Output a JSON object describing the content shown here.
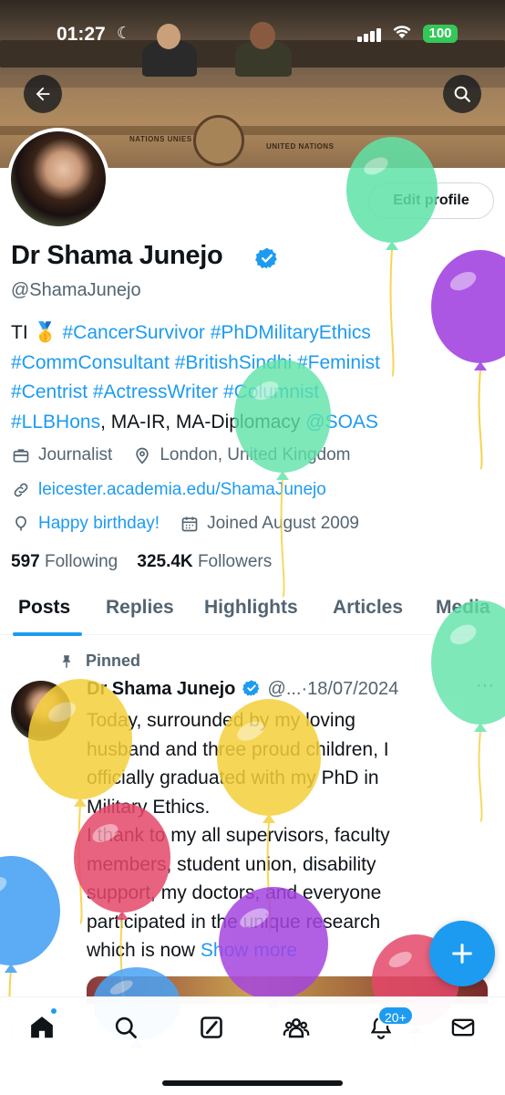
{
  "status_bar": {
    "time": "01:27",
    "battery": "100"
  },
  "profile": {
    "display_name": "Dr Shama Junejo",
    "handle": "@ShamaJunejo",
    "edit_profile_label": "Edit profile",
    "bio_lines": [
      [
        {
          "t": "TI 🥇 ",
          "tag": false
        },
        {
          "t": "#CancerSurvivor #PhDMilitaryEthics",
          "tag": true
        }
      ],
      [
        {
          "t": "#CommConsultant #BritishSindhi #Feminist",
          "tag": true
        }
      ],
      [
        {
          "t": "#Centrist #ActressWriter #Columnist",
          "tag": true
        }
      ],
      [
        {
          "t": "#LLBHons",
          "tag": true
        },
        {
          "t": ", MA-IR, MA-Diplomacy ",
          "tag": false
        },
        {
          "t": "@SOAS",
          "tag": true
        }
      ]
    ],
    "category": "Journalist",
    "location": "London, United Kingdom",
    "website": "leicester.academia.edu/ShamaJunejo",
    "birthday": "Happy birthday!",
    "joined": "Joined August 2009",
    "following_count": "597",
    "following_label": "Following",
    "followers_count": "325.4K",
    "followers_label": "Followers"
  },
  "tabs": [
    "Posts",
    "Replies",
    "Highlights",
    "Articles",
    "Media"
  ],
  "active_tab": "Posts",
  "post": {
    "pinned_label": "Pinned",
    "author": "Dr Shama Junejo",
    "handle_trunc": "@...",
    "date": "·18/07/2024",
    "more_icon": "···",
    "text_lines": [
      "Today, surrounded by my loving",
      "husband and three proud children, I",
      "officially graduated with my PhD in",
      "Military Ethics.",
      "I thank to my all supervisors, faculty",
      "members, student union, disability",
      "support, my doctors, and everyone",
      "participated in the unique research"
    ],
    "last_line": "which is now ",
    "show_more": "Show more"
  },
  "bottom_nav": {
    "items": [
      "home-icon",
      "search-icon",
      "grok-icon",
      "communities-icon",
      "notifications-icon",
      "messages-icon"
    ],
    "notifications_badge": "20+"
  },
  "colors": {
    "accent": "#1d9bf0",
    "text_primary": "#0f1419",
    "text_secondary": "#536471",
    "balloon_green": "#5fe3a8",
    "balloon_purple": "#a445e0",
    "balloon_yellow": "#f5cf3a",
    "balloon_red": "#e5486a",
    "balloon_blue": "#4aa3f5"
  }
}
